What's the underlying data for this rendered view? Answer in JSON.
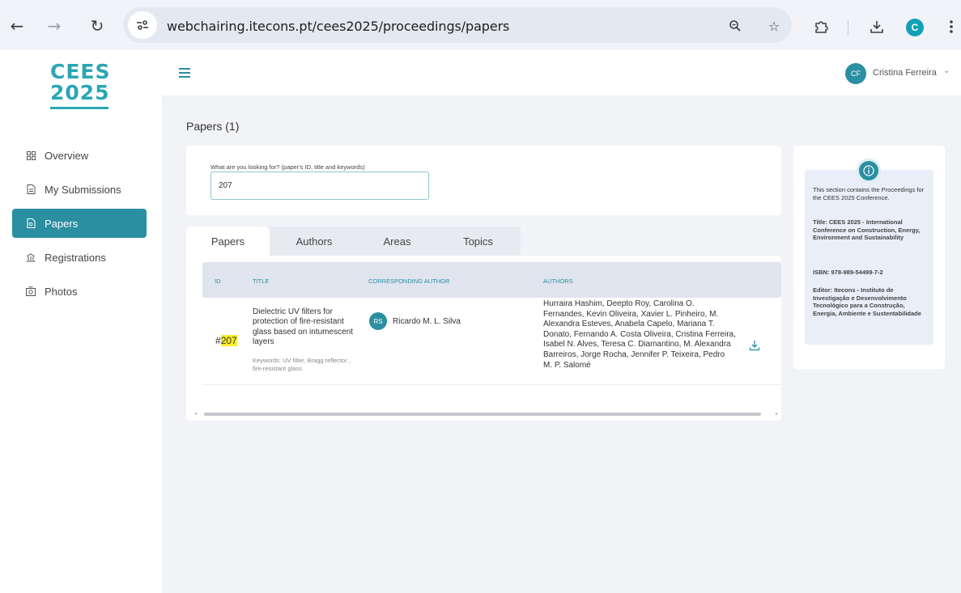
{
  "browser": {
    "url": "webchairing.itecons.pt/cees2025/proceedings/papers",
    "profile_initial": "C",
    "icons": {
      "back": "arrow-left-icon",
      "forward": "arrow-right-icon",
      "reload": "reload-icon",
      "site_settings": "tune-icon",
      "zoom": "zoom-icon",
      "bookmark": "star-icon",
      "extensions": "puzzle-icon",
      "download": "download-icon",
      "menu": "kebab-menu-icon"
    }
  },
  "sidebar": {
    "logo_line1": "CEES",
    "logo_line2": "2025",
    "items": [
      {
        "label": "Overview",
        "icon": "grid-icon",
        "active": false
      },
      {
        "label": "My Submissions",
        "icon": "document-icon",
        "active": false
      },
      {
        "label": "Papers",
        "icon": "papers-icon",
        "active": true
      },
      {
        "label": "Registrations",
        "icon": "building-icon",
        "active": false
      },
      {
        "label": "Photos",
        "icon": "camera-icon",
        "active": false
      }
    ]
  },
  "header": {
    "user_initials": "CF",
    "user_name": "Cristina Ferreira"
  },
  "main": {
    "title": "Papers (1)",
    "search": {
      "label": "What are you looking for? (paper's ID, title and keywords)",
      "value": "207"
    },
    "tabs": [
      {
        "label": "Papers",
        "active": true
      },
      {
        "label": "Authors",
        "active": false
      },
      {
        "label": "Areas",
        "active": false
      },
      {
        "label": "Topics",
        "active": false
      }
    ],
    "table": {
      "columns": [
        "ID",
        "TITLE",
        "CORRESPONDING AUTHOR",
        "AUTHORS"
      ],
      "rows": [
        {
          "id_prefix": "#",
          "id": "207",
          "title": "Dielectric UV filters for protection of fire-resistant glass based on intumescent layers",
          "keywords": "Keywords: UV filter, Bragg reflector , fire-resistant glass",
          "corr_initials": "RS",
          "corr_author": "Ricardo M. L. Silva",
          "authors": "Hurraira Hashim, Deepto Roy, Carolina O. Fernandes, Kevin Oliveira, Xavier L. Pinheiro, M. Alexandra Esteves, Anabela Capelo, Mariana T. Donato, Fernando A. Costa Oliveira, Cristina Ferreira, Isabel N. Alves, Teresa C. Diamantino, M. Alexandra Barreiros, Jorge Rocha, Jennifer P. Teixeira, Pedro M. P. Salomé"
        }
      ]
    }
  },
  "info_panel": {
    "intro": "This section contains the Proceedings for the CEES 2025 Conference.",
    "title": "Title: CEES 2025 - International Conference on Construction, Energy, Environment and Sustainability",
    "isbn": "ISBN: 978-989-54499-7-2",
    "editor": "Editor: Itecons - Instituto de Investigação e Desenvolvimento Tecnológico para a Construção, Energia, Ambiente e Sustentabilidade"
  },
  "colors": {
    "accent": "#2a8fa0",
    "logo": "#2aa6b5",
    "highlight": "#f8ef2a",
    "main_bg": "#f2f3f7"
  }
}
